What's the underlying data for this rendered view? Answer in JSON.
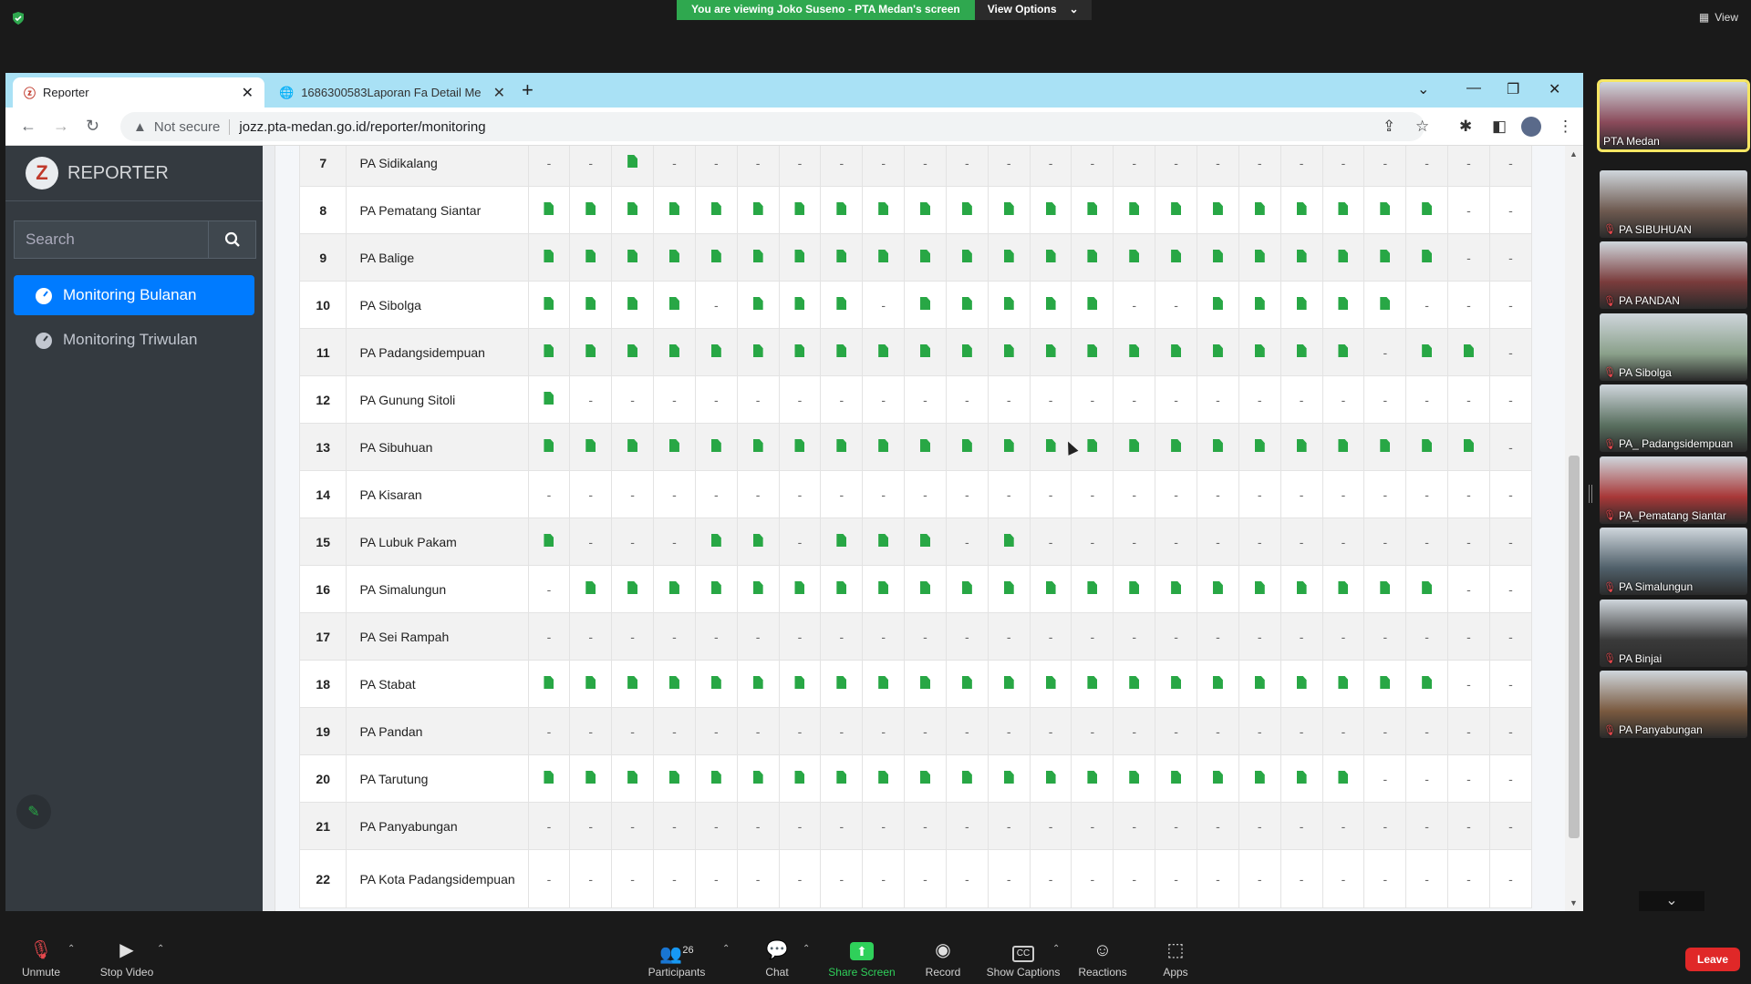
{
  "zoom": {
    "sharing_banner": "You are viewing Joko Suseno - PTA Medan's screen",
    "view_options": "View Options",
    "view_label": "View",
    "participants_count": "26",
    "toolbar": {
      "unmute": "Unmute",
      "stop_video": "Stop Video",
      "participants": "Participants",
      "chat": "Chat",
      "share_screen": "Share Screen",
      "record": "Record",
      "show_captions": "Show Captions",
      "reactions": "Reactions",
      "apps": "Apps",
      "leave": "Leave"
    },
    "gallery": [
      {
        "name": "PTA Medan",
        "muted": false,
        "bg": "#8a4a5a"
      },
      {
        "name": "PA SIBUHUAN",
        "muted": true,
        "bg": "#6e5a50"
      },
      {
        "name": "PA PANDAN",
        "muted": true,
        "bg": "#7a3c3c"
      },
      {
        "name": "PA Sibolga",
        "muted": true,
        "bg": "#8aa08a"
      },
      {
        "name": "PA_ Padangsidempuan",
        "muted": true,
        "bg": "#5a7060"
      },
      {
        "name": "PA_Pematang Siantar",
        "muted": true,
        "bg": "#a83838"
      },
      {
        "name": "PA Simalungun",
        "muted": true,
        "bg": "#50606a"
      },
      {
        "name": "PA Binjai",
        "muted": true,
        "bg": "#3a3a3a"
      },
      {
        "name": "PA Panyabungan",
        "muted": true,
        "bg": "#7a5a40"
      }
    ]
  },
  "browser": {
    "tabs": [
      {
        "title": "Reporter"
      },
      {
        "title": "1686300583Laporan Fa Detail Me"
      }
    ],
    "not_secure": "Not secure",
    "url": "jozz.pta-medan.go.id/reporter/monitoring"
  },
  "app": {
    "brand": "REPORTER",
    "search_placeholder": "Search",
    "nav": [
      {
        "label": "Monitoring Bulanan",
        "active": true
      },
      {
        "label": "Monitoring Triwulan",
        "active": false
      }
    ]
  },
  "table": {
    "rows": [
      {
        "no": "7",
        "name": "PA Sidikalang",
        "cells": "--1--------------------------"
      },
      {
        "no": "8",
        "name": "PA Pematang Siantar",
        "cells": "1111111111111111111111--"
      },
      {
        "no": "9",
        "name": "PA Balige",
        "cells": "1111111111111111111111--"
      },
      {
        "no": "10",
        "name": "PA Sibolga",
        "cells": "1111-111-11111--11111--"
      },
      {
        "no": "11",
        "name": "PA Padangsidempuan",
        "cells": "11111111111111111111-11--"
      },
      {
        "no": "12",
        "name": "PA Gunung Sitoli",
        "cells": "1-----------------------"
      },
      {
        "no": "13",
        "name": "PA Sibuhuan",
        "cells": "11111111111111111111111-"
      },
      {
        "no": "14",
        "name": "PA Kisaran",
        "cells": "------------------------"
      },
      {
        "no": "15",
        "name": "PA Lubuk Pakam",
        "cells": "1---11-111-1------------"
      },
      {
        "no": "16",
        "name": "PA Simalungun",
        "cells": "-111111111111111111111--"
      },
      {
        "no": "17",
        "name": "PA Sei Rampah",
        "cells": "------------------------"
      },
      {
        "no": "18",
        "name": "PA Stabat",
        "cells": "1111111111111111111111--"
      },
      {
        "no": "19",
        "name": "PA Pandan",
        "cells": "------------------------"
      },
      {
        "no": "20",
        "name": "PA Tarutung",
        "cells": "11111111111111111111----"
      },
      {
        "no": "21",
        "name": "PA Panyabungan",
        "cells": "------------------------"
      },
      {
        "no": "22",
        "name": "PA Kota Padangsidempuan",
        "cells": "------------------------"
      }
    ]
  }
}
